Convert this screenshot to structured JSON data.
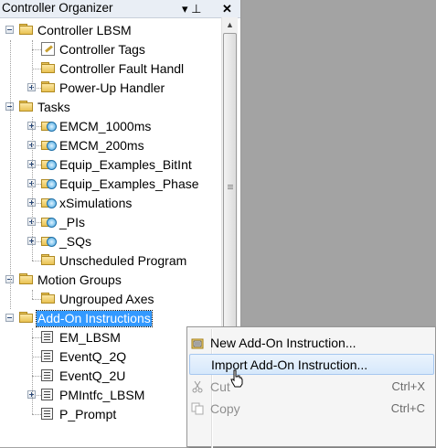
{
  "panel": {
    "title": "Controller Organizer",
    "pin_glyph": "▾ ⊥",
    "close_glyph": "✕"
  },
  "tree": {
    "items": [
      {
        "label": "Controller LBSM",
        "icon": "folder-icon",
        "expander": "minus"
      },
      {
        "label": "Controller Tags",
        "icon": "tag-icon",
        "expander": ""
      },
      {
        "label": "Controller Fault Handl",
        "icon": "folder-icon",
        "expander": ""
      },
      {
        "label": "Power-Up Handler",
        "icon": "folder-icon",
        "expander": "plus"
      },
      {
        "label": "Tasks",
        "icon": "folder-icon",
        "expander": "minus"
      },
      {
        "label": "EMCM_1000ms",
        "icon": "task-icon",
        "expander": "plus"
      },
      {
        "label": "EMCM_200ms",
        "icon": "task-icon",
        "expander": "plus"
      },
      {
        "label": "Equip_Examples_BitInt",
        "icon": "task-icon",
        "expander": "plus"
      },
      {
        "label": "Equip_Examples_Phase",
        "icon": "task-icon",
        "expander": "plus"
      },
      {
        "label": "xSimulations",
        "icon": "task-icon",
        "expander": "plus"
      },
      {
        "label": "_PIs",
        "icon": "task-icon",
        "expander": "plus"
      },
      {
        "label": "_SQs",
        "icon": "task-icon",
        "expander": "plus"
      },
      {
        "label": "Unscheduled Program",
        "icon": "folder-icon",
        "expander": ""
      },
      {
        "label": "Motion Groups",
        "icon": "folder-icon",
        "expander": "minus"
      },
      {
        "label": "Ungrouped Axes",
        "icon": "folder-icon",
        "expander": ""
      },
      {
        "label": "Add-On Instructions",
        "icon": "folder-icon",
        "expander": "minus",
        "selected": true
      },
      {
        "label": "EM_LBSM",
        "icon": "aoi-icon",
        "expander": ""
      },
      {
        "label": "EventQ_2Q",
        "icon": "aoi-icon",
        "expander": ""
      },
      {
        "label": "EventQ_2U",
        "icon": "aoi-icon",
        "expander": ""
      },
      {
        "label": "PMIntfc_LBSM",
        "icon": "aoi-icon",
        "expander": "plus"
      },
      {
        "label": "P_Prompt",
        "icon": "aoi-icon",
        "expander": ""
      }
    ]
  },
  "context_menu": {
    "items": [
      {
        "label": "New Add-On Instruction...",
        "shortcut": "",
        "icon": "new-aoi-icon",
        "highlighted": false,
        "disabled": false
      },
      {
        "label": "Import Add-On Instruction...",
        "shortcut": "",
        "icon": "",
        "highlighted": true,
        "disabled": false
      },
      {
        "label": "Cut",
        "shortcut": "Ctrl+X",
        "icon": "scissors-icon",
        "highlighted": false,
        "disabled": true
      },
      {
        "label": "Copy",
        "shortcut": "Ctrl+C",
        "icon": "copy-icon",
        "highlighted": false,
        "disabled": true
      }
    ]
  },
  "colors": {
    "selection": "#3399ff",
    "workspace": "#a3a3a3",
    "menu_highlight": "#d6e8fb"
  }
}
